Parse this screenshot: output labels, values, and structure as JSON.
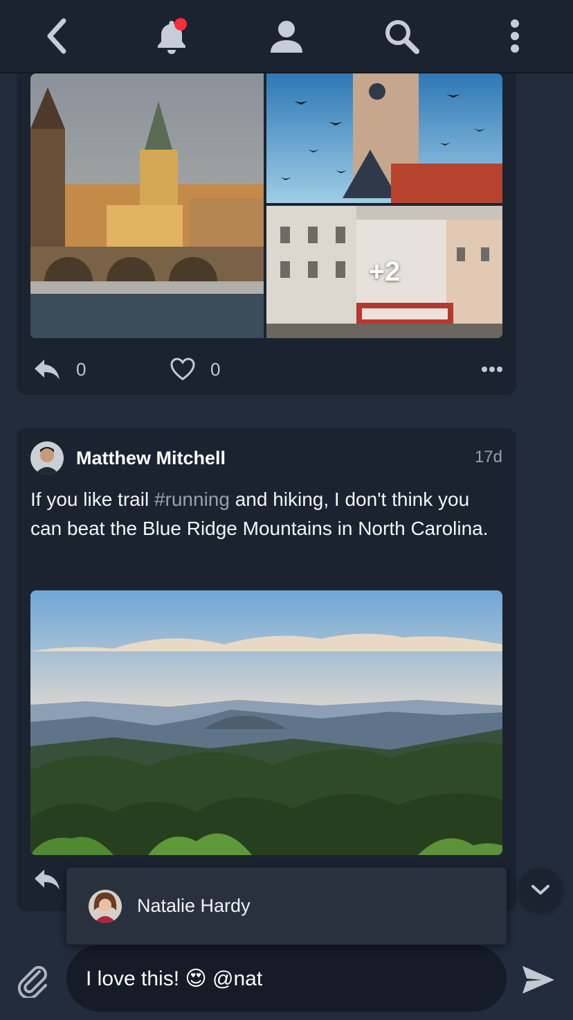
{
  "topbar": {
    "icons": [
      "back-arrow-icon",
      "bell-icon",
      "person-icon",
      "search-icon",
      "more-vertical-icon"
    ],
    "notification_dot_color": "#ff2d3c"
  },
  "post1": {
    "more_photos": "+2",
    "reply_count": "0",
    "like_count": "0"
  },
  "post2": {
    "author": "Matthew Mitchell",
    "time": "17d",
    "text_before": "If you like trail ",
    "hashtag": "#running",
    "text_after": " and hiking, I don't think you can beat the Blue Ridge Mountains in North Carolina."
  },
  "mention_suggestion": {
    "name": "Natalie Hardy"
  },
  "composer": {
    "value": "I love this! 😍 @nat"
  },
  "colors": {
    "background": "#222c3c",
    "card": "#1b2330",
    "muted_text": "#98a1ae"
  }
}
